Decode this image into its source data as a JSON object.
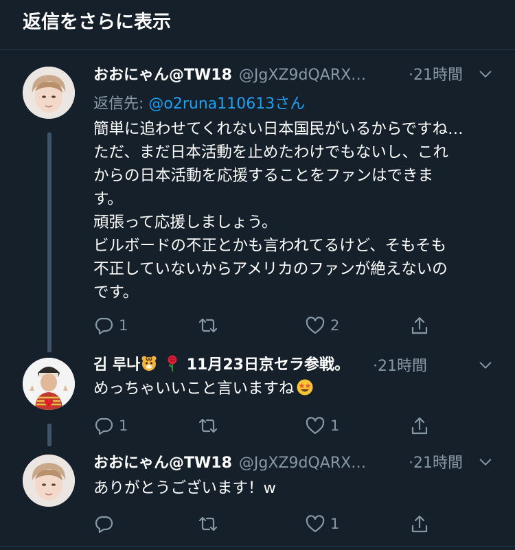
{
  "header": {
    "title": "返信をさらに表示"
  },
  "tweets": [
    {
      "name": "おおにゃん@TW18",
      "handle": "@JgXZ9dQARX…",
      "time": "·21時間",
      "reply_prefix": "返信先: ",
      "reply_mention": "@o2runa110613さん",
      "lines": [
        "簡単に追わせてくれない日本国民がいるからですね…",
        "ただ、まだ日本活動を止めたわけでもないし、これ",
        "からの日本活動を応援することをファンはできま",
        "す。",
        "頑張って応援しましょう。",
        "ビルボードの不正とかも言われてるけど、そもそも",
        "不正していないからアメリカのファンが絶えないの",
        "です。"
      ],
      "counts": {
        "reply": "1",
        "retweet": "",
        "like": "2"
      }
    },
    {
      "name_part1": "김 루나",
      "name_part2": "11月23日京セラ参戦。",
      "time": "·21時間",
      "text": "めっちゃいいこと言いますね",
      "counts": {
        "reply": "1",
        "retweet": "",
        "like": "1"
      }
    },
    {
      "name": "おおにゃん@TW18",
      "handle": "@JgXZ9dQARX…",
      "time": "·21時間",
      "text": "ありがとうございます！w",
      "counts": {
        "reply": "",
        "retweet": "",
        "like": "1"
      }
    }
  ],
  "icons": {
    "reply": "reply-icon",
    "retweet": "retweet-icon",
    "like": "like-icon",
    "share": "share-icon",
    "more": "chevron-down-icon",
    "emoji_tiger": "tiger-face-emoji",
    "emoji_rose": "rose-emoji",
    "emoji_star": "star-struck-emoji"
  },
  "colors": {
    "background": "#15202b",
    "secondary_text": "#8899a6",
    "link": "#1da1f2",
    "thread_line": "#3d5466"
  }
}
